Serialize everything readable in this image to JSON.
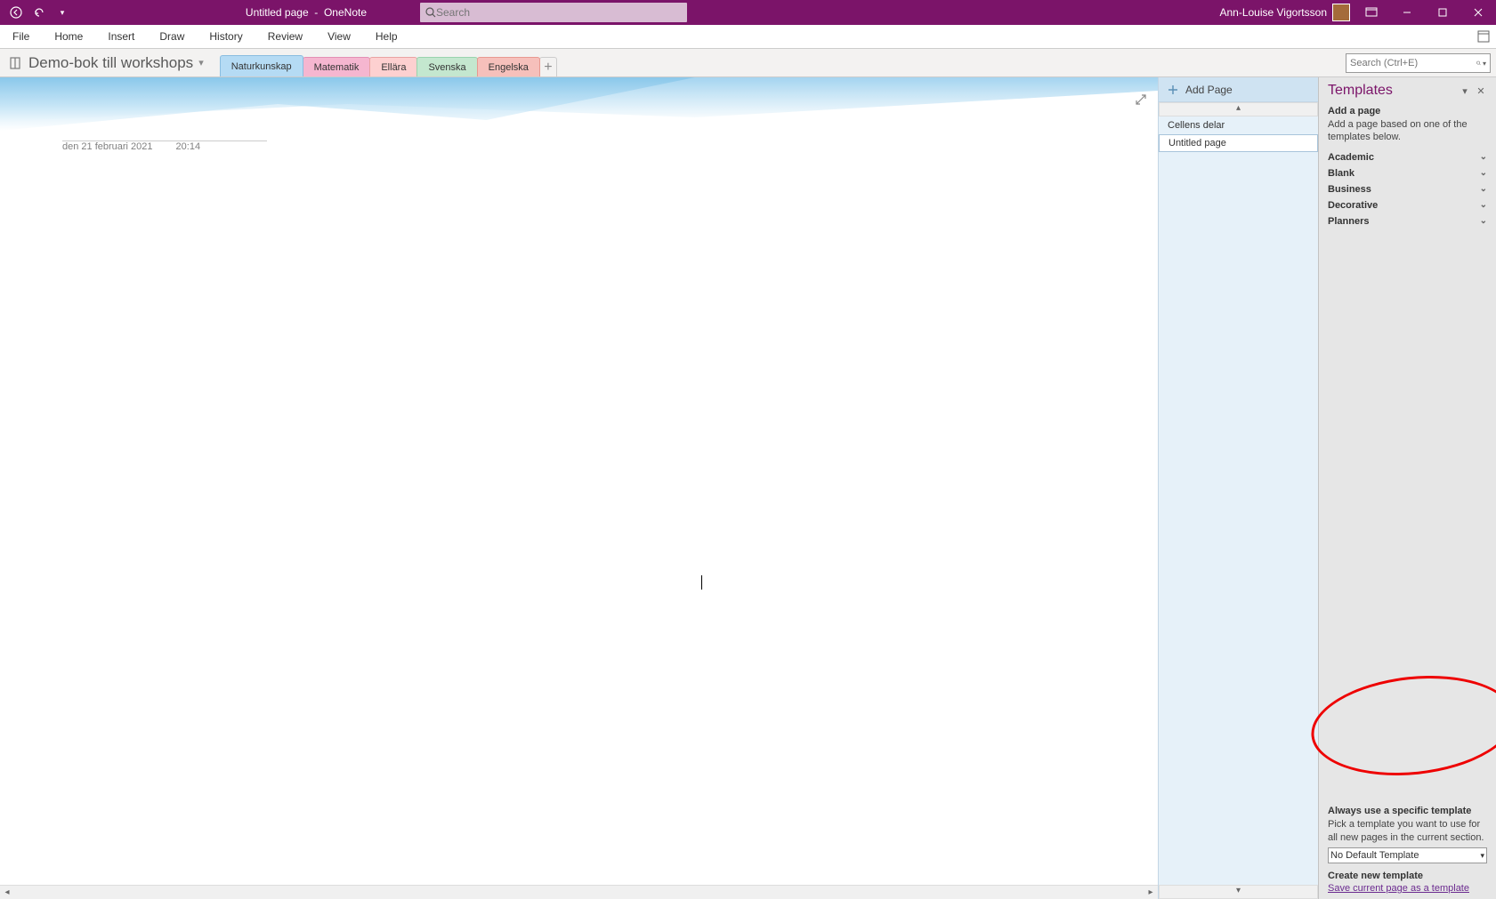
{
  "titlebar": {
    "title_page": "Untitled page",
    "title_app": "OneNote",
    "search_placeholder": "Search",
    "user_name": "Ann-Louise Vigortsson"
  },
  "ribbon": {
    "tabs": [
      "File",
      "Home",
      "Insert",
      "Draw",
      "History",
      "Review",
      "View",
      "Help"
    ]
  },
  "notebook": {
    "name": "Demo-bok till workshops",
    "sections": [
      {
        "label": "Naturkunskap",
        "cls": "active"
      },
      {
        "label": "Matematik",
        "cls": "pink"
      },
      {
        "label": "Ellära",
        "cls": "pink2"
      },
      {
        "label": "Svenska",
        "cls": "green"
      },
      {
        "label": "Engelska",
        "cls": "salmon"
      }
    ],
    "search_placeholder": "Search (Ctrl+E)"
  },
  "page": {
    "date": "den 21 februari 2021",
    "time": "20:14"
  },
  "pagelist": {
    "add_label": "Add Page",
    "items": [
      {
        "label": "Cellens delar",
        "sel": false
      },
      {
        "label": "Untitled page",
        "sel": true
      }
    ]
  },
  "templates": {
    "title": "Templates",
    "add_heading": "Add a page",
    "add_desc": "Add a page based on one of the templates below.",
    "categories": [
      "Academic",
      "Blank",
      "Business",
      "Decorative",
      "Planners"
    ],
    "always_heading": "Always use a specific template",
    "always_desc": "Pick a template you want to use for all new pages in the current section.",
    "default_template": "No Default Template",
    "create_heading": "Create new template",
    "save_link": "Save current page as a template"
  }
}
